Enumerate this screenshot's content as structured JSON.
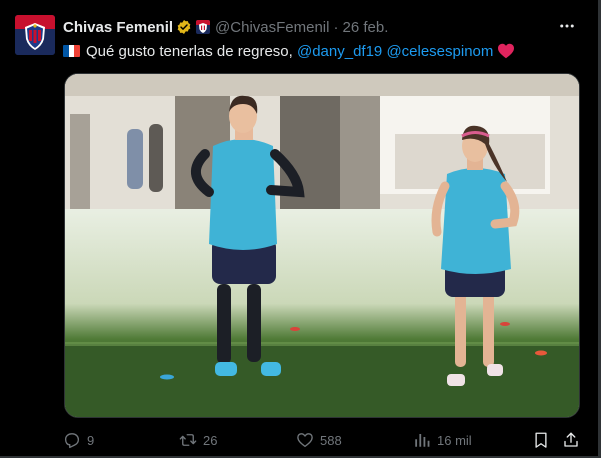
{
  "tweet": {
    "author_name": "Chivas Femenil",
    "handle": "@ChivasFemenil",
    "separator": "·",
    "date": "26 feb.",
    "text_prefix": "Qué gusto tenerlas de regreso,",
    "mentions": [
      "@dany_df19",
      "@celesespinom"
    ],
    "flag_emoji": "france-flag",
    "trailing_emoji": "red-heart"
  },
  "stats": {
    "replies": "9",
    "retweets": "26",
    "likes": "588",
    "views": "16 mil"
  },
  "colors": {
    "background": "#000000",
    "text": "#e7e9ea",
    "muted": "#71767b",
    "link": "#1d9bf0",
    "verified_gold": "#e2b719",
    "heart_red": "#e0245e",
    "jersey_blue": "#3fb3d6"
  },
  "icons": {
    "more": "more-dots-icon",
    "reply": "reply-icon",
    "retweet": "retweet-icon",
    "like": "heart-icon",
    "views": "views-icon",
    "bookmark": "bookmark-icon",
    "share": "share-icon"
  }
}
